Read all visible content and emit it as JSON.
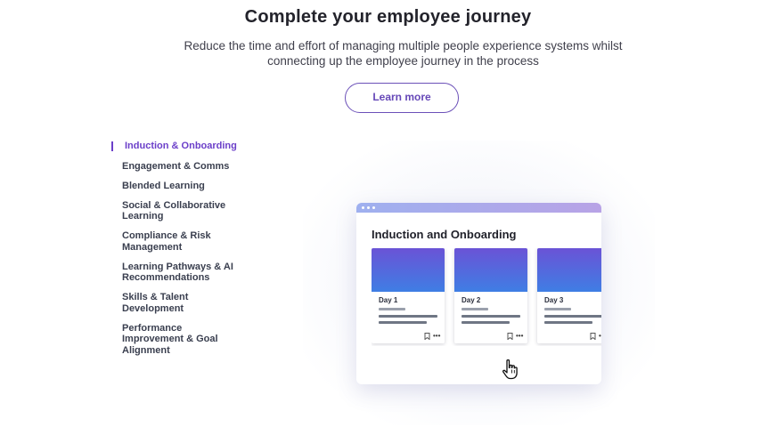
{
  "header": {
    "title": "Complete your employee journey",
    "subtitle": "Reduce the time and effort of managing multiple people experience systems whilst connecting up the employee journey in the process",
    "cta_label": "Learn more"
  },
  "nav": {
    "items": [
      {
        "label": "Induction & Onboarding",
        "active": true
      },
      {
        "label": "Engagement & Comms"
      },
      {
        "label": "Blended Learning"
      },
      {
        "label": "Social & Collaborative Learning"
      },
      {
        "label": "Compliance & Risk Management"
      },
      {
        "label": "Learning Pathways & AI Recommendations"
      },
      {
        "label": "Skills & Talent Development"
      },
      {
        "label": "Performance Improvement & Goal Alignment"
      }
    ]
  },
  "preview": {
    "title": "Induction and Onboarding",
    "tiles": [
      {
        "label": "Day 1"
      },
      {
        "label": "Day 2"
      },
      {
        "label": "Day 3"
      }
    ],
    "icons": {
      "bookmark": "bookmark-icon",
      "more": "more-icon",
      "cursor": "hand-pointer-icon"
    }
  },
  "colors": {
    "accent": "#6b3fc9",
    "gradient_top": "#6a53d6",
    "gradient_bottom": "#3f7ee4",
    "header_bar": "#9fb0ef"
  }
}
